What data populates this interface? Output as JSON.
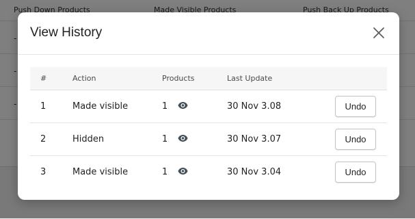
{
  "background": {
    "columns": [
      "Push Down Products",
      "Made Visible Products",
      "Push Back Up Products"
    ],
    "rows": [
      "-",
      "-",
      "-"
    ]
  },
  "modal": {
    "title": "View History",
    "close_icon": "close-icon",
    "table": {
      "headers": [
        "#",
        "Action",
        "Products",
        "Last Update"
      ],
      "rows": [
        {
          "num": "1",
          "action": "Made visible",
          "products": "1",
          "last_update": "30 Nov 3.08",
          "button": "Undo"
        },
        {
          "num": "2",
          "action": "Hidden",
          "products": "1",
          "last_update": "30 Nov 3.07",
          "button": "Undo"
        },
        {
          "num": "3",
          "action": "Made visible",
          "products": "1",
          "last_update": "30 Nov 3.04",
          "button": "Undo"
        }
      ],
      "products_icon": "eye-icon"
    }
  }
}
